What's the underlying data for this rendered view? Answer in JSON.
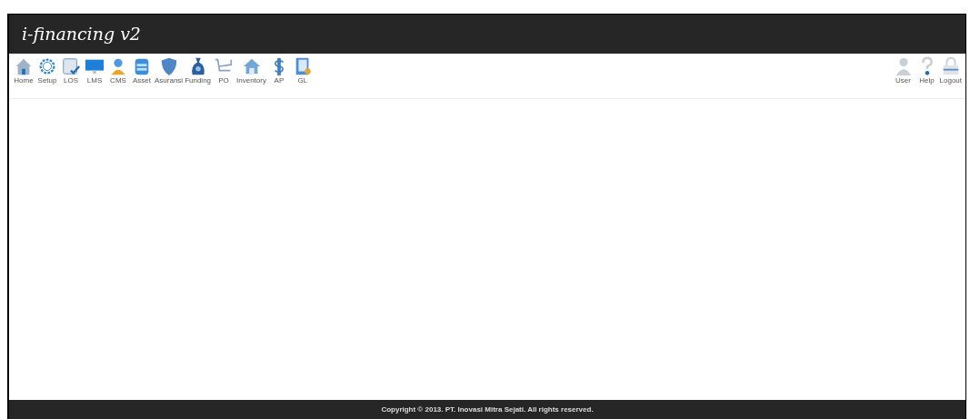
{
  "header": {
    "title": "i-financing v2"
  },
  "toolbar": {
    "items": [
      {
        "label": "Home",
        "kind": "house"
      },
      {
        "label": "Setup",
        "kind": "gear"
      },
      {
        "label": "LOS",
        "kind": "checklist"
      },
      {
        "label": "LMS",
        "kind": "monitor"
      },
      {
        "label": "CMS",
        "kind": "person"
      },
      {
        "label": "Asset",
        "kind": "database"
      },
      {
        "label": "Asuransi",
        "kind": "shield"
      },
      {
        "label": "Funding",
        "kind": "moneybag"
      },
      {
        "label": "PO",
        "kind": "cart"
      },
      {
        "label": "Inventory",
        "kind": "warehouse"
      },
      {
        "label": "AP",
        "kind": "dollar"
      },
      {
        "label": "GL",
        "kind": "ledger"
      }
    ],
    "right_items": [
      {
        "label": "User",
        "kind": "user"
      },
      {
        "label": "Help",
        "kind": "help"
      },
      {
        "label": "Logout",
        "kind": "lock"
      }
    ]
  },
  "footer": {
    "text": "Copyright © 2013. PT. Inovasi Mitra Sejati. All rights reserved."
  }
}
